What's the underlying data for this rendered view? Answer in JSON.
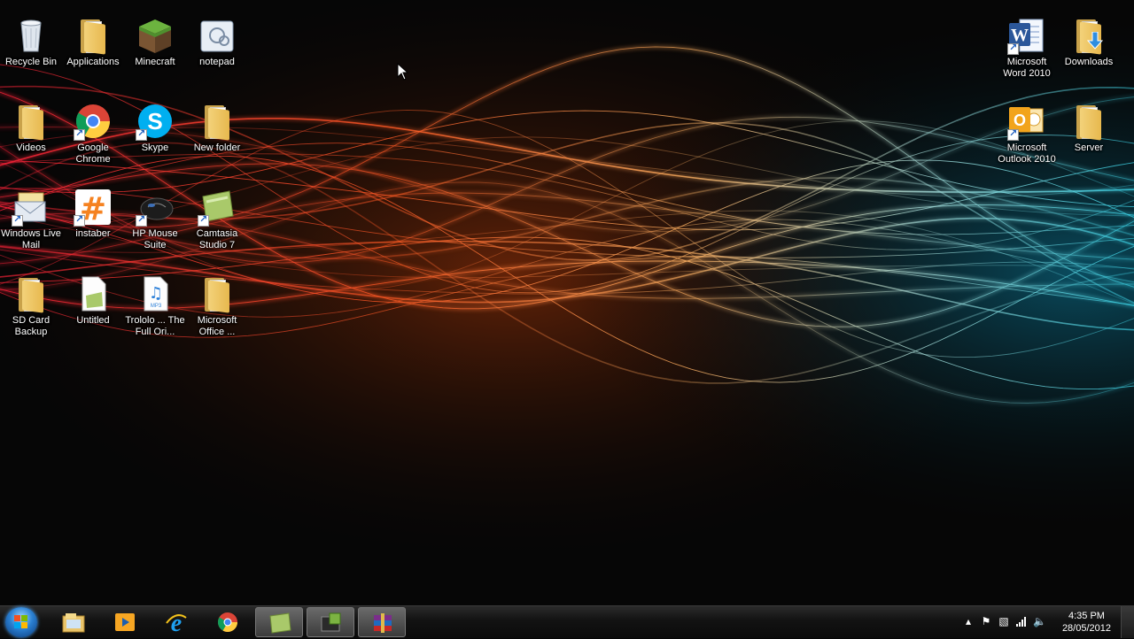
{
  "desktop_icons": [
    {
      "id": "recycle-bin",
      "label": "Recycle Bin",
      "icon": "recycle-bin-icon"
    },
    {
      "id": "applications",
      "label": "Applications",
      "icon": "folder-icon"
    },
    {
      "id": "minecraft",
      "label": "Minecraft",
      "icon": "minecraft-icon"
    },
    {
      "id": "notepad",
      "label": "notepad",
      "icon": "notepad-icon"
    },
    {
      "id": "videos",
      "label": "Videos",
      "icon": "folder-icon"
    },
    {
      "id": "google-chrome",
      "label": "Google Chrome",
      "icon": "chrome-icon"
    },
    {
      "id": "skype",
      "label": "Skype",
      "icon": "skype-icon"
    },
    {
      "id": "new-folder",
      "label": "New folder",
      "icon": "folder-icon"
    },
    {
      "id": "windows-live-mail",
      "label": "Windows Live Mail",
      "icon": "mail-icon"
    },
    {
      "id": "instaber",
      "label": "instaber",
      "icon": "hashtag-icon"
    },
    {
      "id": "hp-mouse-suite",
      "label": "HP Mouse Suite",
      "icon": "mouse-icon"
    },
    {
      "id": "camtasia",
      "label": "Camtasia Studio 7",
      "icon": "camtasia-icon"
    },
    {
      "id": "sd-card-backup",
      "label": "SD Card Backup",
      "icon": "folder-icon"
    },
    {
      "id": "untitled",
      "label": "Untitled",
      "icon": "document-icon"
    },
    {
      "id": "trololo",
      "label": "Trololo ... The Full Ori...",
      "icon": "mp3-file-icon"
    },
    {
      "id": "microsoft-office",
      "label": "Microsoft Office ...",
      "icon": "folder-icon"
    },
    {
      "id": "word-2010",
      "label": "Microsoft Word 2010",
      "icon": "word-icon"
    },
    {
      "id": "downloads",
      "label": "Downloads",
      "icon": "downloads-folder-icon"
    },
    {
      "id": "outlook-2010",
      "label": "Microsoft Outlook 2010",
      "icon": "outlook-icon"
    },
    {
      "id": "server",
      "label": "Server",
      "icon": "folder-icon"
    }
  ],
  "taskbar": {
    "start_button": "start-orb-icon",
    "pinned": [
      {
        "id": "explorer",
        "icon": "file-explorer-icon",
        "active": false
      },
      {
        "id": "media-player",
        "icon": "media-player-icon",
        "active": false
      },
      {
        "id": "internet-explorer",
        "icon": "internet-explorer-icon",
        "active": false
      },
      {
        "id": "chrome",
        "icon": "chrome-icon",
        "active": false
      },
      {
        "id": "camtasia",
        "icon": "camtasia-icon",
        "active": true
      },
      {
        "id": "recorder",
        "icon": "recorder-icon",
        "active": true
      },
      {
        "id": "winrar",
        "icon": "winrar-icon",
        "active": true
      }
    ],
    "tray": {
      "clock_time": "4:35 PM",
      "clock_date": "28/05/2012",
      "icons": [
        "show-hidden-icons-icon",
        "action-center-flag-icon",
        "power-icon",
        "network-signal-icon",
        "volume-icon"
      ]
    }
  },
  "colors": {
    "taskbar": "#121212",
    "wave_red": "#ff2a2a",
    "wave_orange": "#ff9a3c",
    "wave_teal": "#3fd6e0"
  }
}
